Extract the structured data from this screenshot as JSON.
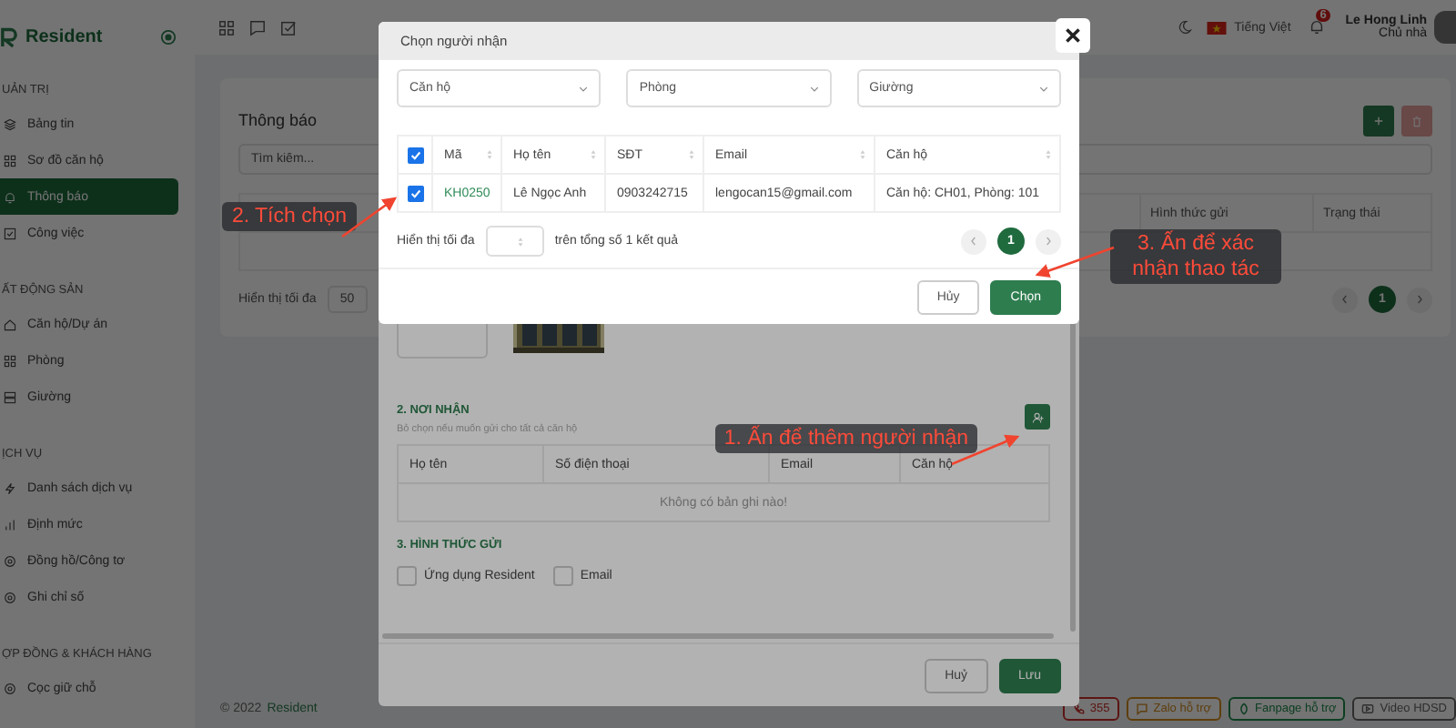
{
  "app": {
    "logo": "Resident"
  },
  "top_bar": {
    "language": "Tiếng Việt",
    "notification_count": "6",
    "user_name": "Le Hong Linh",
    "user_role": "Chủ nhà"
  },
  "sidebar": {
    "sections": [
      {
        "title": "UẢN TRỊ",
        "items": [
          {
            "label": "Bảng tin",
            "selected": false
          },
          {
            "label": "Sơ đồ căn hộ",
            "selected": false
          },
          {
            "label": "Thông báo",
            "selected": true
          },
          {
            "label": "Công việc",
            "selected": false
          }
        ]
      },
      {
        "title": "ẤT ĐỘNG SẢN",
        "items": [
          {
            "label": "Căn hộ/Dự án",
            "selected": false
          },
          {
            "label": "Phòng",
            "selected": false
          },
          {
            "label": "Giường",
            "selected": false
          }
        ]
      },
      {
        "title": "ỊCH VỤ",
        "items": [
          {
            "label": "Danh sách dịch vụ",
            "selected": false
          },
          {
            "label": "Định mức",
            "selected": false
          },
          {
            "label": "Đồng hồ/Công tơ",
            "selected": false
          },
          {
            "label": "Ghi chỉ số",
            "selected": false
          }
        ]
      },
      {
        "title": "ỢP ĐỒNG & KHÁCH HÀNG",
        "items": [
          {
            "label": "Cọc giữ chỗ",
            "selected": false
          }
        ]
      }
    ]
  },
  "page": {
    "title": "Thông báo",
    "search_placeholder": "Tìm kiếm...",
    "columns": [
      "Hình thức gửi",
      "Trạng thái"
    ],
    "page_size_label": "Hiển thị tối đa",
    "page_size": "50",
    "pages": [
      {
        "label": "1",
        "selected": true
      }
    ]
  },
  "footer": {
    "copyright": "© 2022",
    "brand": "Resident",
    "links": [
      {
        "label": "355",
        "kind": "phone"
      },
      {
        "label": "Zalo hỗ trợ",
        "kind": "zalo"
      },
      {
        "label": "Fanpage hỗ trợ",
        "kind": "fanpage"
      },
      {
        "label": "Video HDSD",
        "kind": "video"
      }
    ]
  },
  "form_dialog": {
    "section2_title": "2. NƠI NHẬN",
    "section2_hint": "Bỏ chọn nếu muốn gửi cho tất cả căn hộ",
    "columns": [
      "Họ tên",
      "Số điện thoại",
      "Email",
      "Căn hộ"
    ],
    "empty_text": "Không có bản ghi nào!",
    "section3_title": "3. HÌNH THỨC GỬI",
    "channels": [
      {
        "label": "Ứng dụng Resident",
        "checked": false
      },
      {
        "label": "Email",
        "checked": false
      }
    ],
    "cancel": "Huỷ",
    "save": "Lưu"
  },
  "picker_dialog": {
    "title": "Chọn người nhận",
    "filters": [
      {
        "value": "Căn hộ"
      },
      {
        "value": "Phòng"
      },
      {
        "value": "Giường"
      }
    ],
    "select_all": true,
    "columns": [
      "Mã",
      "Họ tên",
      "SĐT",
      "Email",
      "Căn hộ"
    ],
    "rows": [
      {
        "selected": true,
        "cells": [
          "KH0250",
          "Lê Ngọc Anh",
          "0903242715",
          "lengocan15@gmail.com",
          "Căn hộ: CH01, Phòng: 101"
        ]
      }
    ],
    "page_size_label": "Hiển thị tối đa",
    "total_text": "trên tổng số 1 kết quả",
    "pages": [
      {
        "label": "1",
        "selected": true
      }
    ],
    "cancel": "Hủy",
    "confirm": "Chọn"
  },
  "annotations": [
    {
      "text": "2. Tích chọn"
    },
    {
      "text": "3. Ấn để xác nhận thao tác"
    },
    {
      "text": "1. Ấn để thêm người nhận"
    }
  ]
}
